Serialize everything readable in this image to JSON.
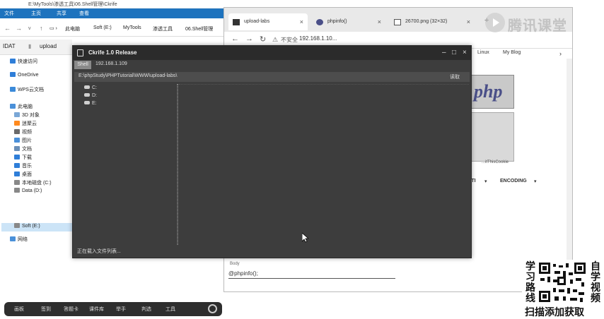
{
  "explorer": {
    "title": "E:\\MyTools\\渗透工具\\06.Shell管理\\Ckrife",
    "ribbon": [
      "文件",
      "主页",
      "共享",
      "查看"
    ],
    "crumbs": [
      "此电脑",
      "Soft (E:)",
      "MyTools",
      "渗透工具",
      "06.Shell管理"
    ],
    "toolbar": {
      "left": "IDAT",
      "right": "upload"
    },
    "nav": [
      {
        "label": "快速访问",
        "color": "#2f7ed8"
      },
      {
        "label": "OneDrive",
        "color": "#2f7ed8"
      },
      {
        "label": "WPS云文档",
        "color": "#3b8ad9"
      },
      {
        "label": "此电脑",
        "color": "#4a90d9"
      },
      {
        "label": "3D 对象",
        "color": "#7aa7d6"
      },
      {
        "label": "迷聚云",
        "color": "#ff8a1e"
      },
      {
        "label": "视频",
        "color": "#6a6a6a"
      },
      {
        "label": "图片",
        "color": "#4a90d9"
      },
      {
        "label": "文档",
        "color": "#6a8fb8"
      },
      {
        "label": "下载",
        "color": "#2f7ed8"
      },
      {
        "label": "音乐",
        "color": "#2f7ed8"
      },
      {
        "label": "桌面",
        "color": "#2f7ed8"
      },
      {
        "label": "本地磁盘 (C:)",
        "color": "#888888"
      },
      {
        "label": "Data (D:)",
        "color": "#888888"
      },
      {
        "label": "Soft (E:)",
        "color": "#888888",
        "selected": true
      },
      {
        "label": "网络",
        "color": "#4a90d9"
      }
    ]
  },
  "browser": {
    "tabs": [
      {
        "label": "upload-labs",
        "icon_color": "#333333",
        "active": true
      },
      {
        "label": "phpinfo()",
        "icon_color": "#4a4f88"
      },
      {
        "label": "26700.png (32×32)",
        "icon_color": "#555555"
      }
    ],
    "security_label": "不安全",
    "url": "192.168.1.10...",
    "bookmarks": [
      "Linux",
      "My Blog"
    ],
    "php_logo_text": "php",
    "hint_text": "...itThisCookie",
    "hackbar": [
      "SSTI",
      "ENCODING"
    ],
    "body_label": "Body",
    "body_value": "@phpinfo();"
  },
  "watermark": {
    "text": "腾讯课堂"
  },
  "ckrife": {
    "title": "Ckrife 1.0 Release",
    "tab_label": "Shell",
    "host": "192.168.1.109",
    "path": "E:\\phpStudy\\PHPTutorial\\WWW\\upload-labs\\",
    "read_button": "读取",
    "drives": [
      "C:",
      "D:",
      "E:"
    ],
    "status": "正在载入文件列表..."
  },
  "taskbar": {
    "items": [
      "画板",
      "签到",
      "答题卡",
      "课件库",
      "举手",
      "判选",
      "工具"
    ]
  },
  "promo": {
    "left_vertical": "学习路线",
    "right_vertical": "自学视频",
    "bottom": "扫描添加获取"
  }
}
